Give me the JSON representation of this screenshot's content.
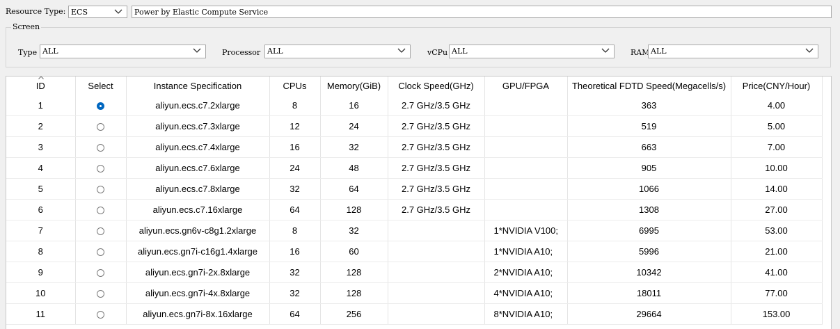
{
  "top": {
    "resource_type_label": "Resource Type:",
    "resource_type_value": "ECS",
    "description": "Power by Elastic Compute Service"
  },
  "screen": {
    "title": "Screen",
    "type_label": "Type",
    "type_value": "ALL",
    "processor_label": "Processor",
    "processor_value": "ALL",
    "vcpu_label": "vCPu",
    "vcpu_value": "ALL",
    "ram_label": "RAM",
    "ram_value": "ALL"
  },
  "table": {
    "columns": [
      "ID",
      "Select",
      "Instance Specification",
      "CPUs",
      "Memory(GiB)",
      "Clock Speed(GHz)",
      "GPU/FPGA",
      "Theoretical FDTD Speed(Megacells/s)",
      "Price(CNY/Hour)"
    ],
    "rows": [
      {
        "id": "1",
        "selected": true,
        "spec": "aliyun.ecs.c7.2xlarge",
        "cpus": "8",
        "memory": "16",
        "clock": "2.7 GHz/3.5 GHz",
        "gpu": "",
        "fdtd": "363",
        "price": "4.00"
      },
      {
        "id": "2",
        "selected": false,
        "spec": "aliyun.ecs.c7.3xlarge",
        "cpus": "12",
        "memory": "24",
        "clock": "2.7 GHz/3.5 GHz",
        "gpu": "",
        "fdtd": "519",
        "price": "5.00"
      },
      {
        "id": "3",
        "selected": false,
        "spec": "aliyun.ecs.c7.4xlarge",
        "cpus": "16",
        "memory": "32",
        "clock": "2.7 GHz/3.5 GHz",
        "gpu": "",
        "fdtd": "663",
        "price": "7.00"
      },
      {
        "id": "4",
        "selected": false,
        "spec": "aliyun.ecs.c7.6xlarge",
        "cpus": "24",
        "memory": "48",
        "clock": "2.7 GHz/3.5 GHz",
        "gpu": "",
        "fdtd": "905",
        "price": "10.00"
      },
      {
        "id": "5",
        "selected": false,
        "spec": "aliyun.ecs.c7.8xlarge",
        "cpus": "32",
        "memory": "64",
        "clock": "2.7 GHz/3.5 GHz",
        "gpu": "",
        "fdtd": "1066",
        "price": "14.00"
      },
      {
        "id": "6",
        "selected": false,
        "spec": "aliyun.ecs.c7.16xlarge",
        "cpus": "64",
        "memory": "128",
        "clock": "2.7 GHz/3.5 GHz",
        "gpu": "",
        "fdtd": "1308",
        "price": "27.00"
      },
      {
        "id": "7",
        "selected": false,
        "spec": "aliyun.ecs.gn6v-c8g1.2xlarge",
        "cpus": "8",
        "memory": "32",
        "clock": "",
        "gpu": "1*NVIDIA V100;",
        "fdtd": "6995",
        "price": "53.00"
      },
      {
        "id": "8",
        "selected": false,
        "spec": "aliyun.ecs.gn7i-c16g1.4xlarge",
        "cpus": "16",
        "memory": "60",
        "clock": "",
        "gpu": "1*NVIDIA A10;",
        "fdtd": "5996",
        "price": "21.00"
      },
      {
        "id": "9",
        "selected": false,
        "spec": "aliyun.ecs.gn7i-2x.8xlarge",
        "cpus": "32",
        "memory": "128",
        "clock": "",
        "gpu": "2*NVIDIA A10;",
        "fdtd": "10342",
        "price": "41.00"
      },
      {
        "id": "10",
        "selected": false,
        "spec": "aliyun.ecs.gn7i-4x.8xlarge",
        "cpus": "32",
        "memory": "128",
        "clock": "",
        "gpu": "4*NVIDIA A10;",
        "fdtd": "18011",
        "price": "77.00"
      },
      {
        "id": "11",
        "selected": false,
        "spec": "aliyun.ecs.gn7i-8x.16xlarge",
        "cpus": "64",
        "memory": "256",
        "clock": "",
        "gpu": "8*NVIDIA A10;",
        "fdtd": "29664",
        "price": "153.00"
      }
    ]
  },
  "icons": {
    "dropdown": "chevron-down-icon",
    "sort": "sort-up-icon",
    "radio": "radio-button-icon"
  },
  "colors": {
    "selected_radio": "#0067c0"
  }
}
